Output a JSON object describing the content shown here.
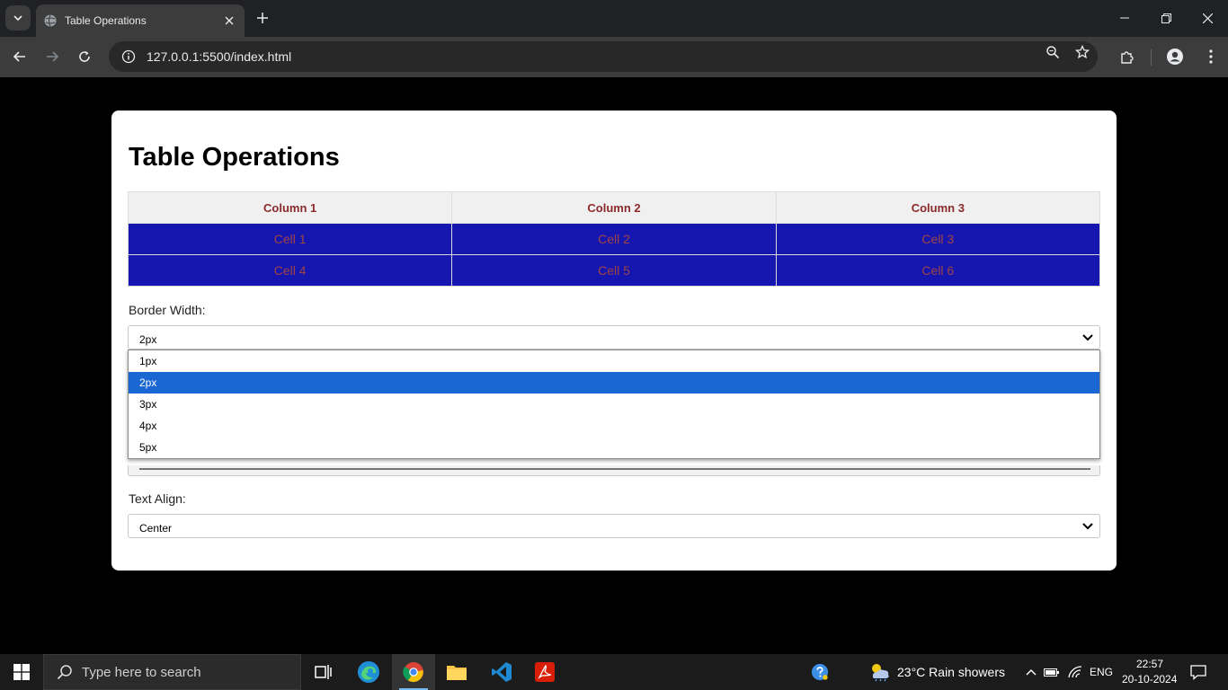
{
  "browser": {
    "tab_title": "Table Operations",
    "url": "127.0.0.1:5500/index.html"
  },
  "page": {
    "title": "Table Operations",
    "table": {
      "headers": [
        "Column 1",
        "Column 2",
        "Column 3"
      ],
      "rows": [
        [
          "Cell 1",
          "Cell 2",
          "Cell 3"
        ],
        [
          "Cell 4",
          "Cell 5",
          "Cell 6"
        ]
      ]
    },
    "border_width": {
      "label": "Border Width:",
      "value": "2px",
      "options": [
        "1px",
        "2px",
        "3px",
        "4px",
        "5px"
      ],
      "selected_index": 1
    },
    "text_align": {
      "label": "Text Align:",
      "value": "Center"
    }
  },
  "colors": {
    "header_bg": "#f0f0f0",
    "header_text": "#8b2a2a",
    "cell_bg": "#1515b0",
    "cell_text": "#a04545",
    "option_selected": "#1a66d2"
  },
  "taskbar": {
    "search_placeholder": "Type here to search",
    "weather": "23°C  Rain showers",
    "language": "ENG",
    "time": "22:57",
    "date": "20-10-2024"
  }
}
